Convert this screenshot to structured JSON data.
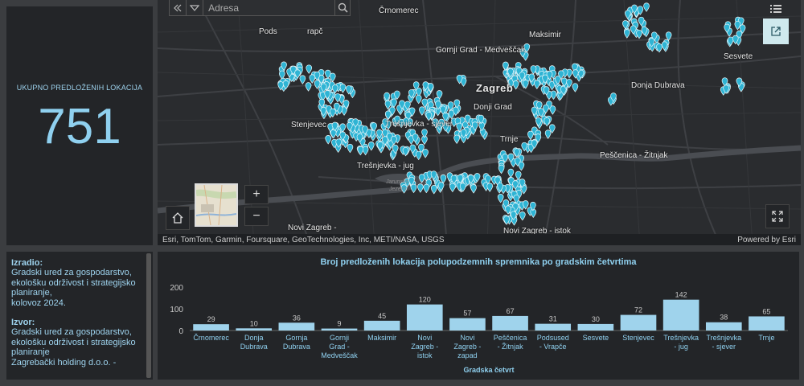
{
  "indicator": {
    "title": "UKUPNO PREDLOŽENIH LOKACIJA",
    "value": "751"
  },
  "map": {
    "search": {
      "placeholder": "Adresa"
    },
    "labels": {
      "crnomerec": "Črnomerec",
      "pods": "Pods",
      "rapc": "rapč",
      "maksimir": "Maksimir",
      "gornji_grad": "Gornji Grad - Medveščak",
      "sesvete": "Sesvete",
      "zagreb": "Zagreb",
      "donji_grad": "Donji Grad",
      "donja_dubrava": "Donja Dubrava",
      "stenjevec": "Stenjevec",
      "tresnjevka_sjever": "Trešnjevka - sjever",
      "trnje": "Trnje",
      "pescenica": "Peščenica - Žitnjak",
      "tresnjevka_jug": "Trešnjevka - jug",
      "jarunsko": "Jarunsko",
      "jezero": "Jezero",
      "novi_zagreb_zapad": "Novi Zagreb -",
      "novi_zagreb_istok": "Novi Zagreb - istok"
    },
    "attribution": "Esri, TomTom, Garmin, Foursquare, GeoTechnologies, Inc, METI/NASA, USGS",
    "powered_by": "Powered by Esri",
    "zoom_in": "+",
    "zoom_out": "−"
  },
  "info": {
    "izradio_label": "Izradio:",
    "izradio_text": "Gradski ured za gospodarstvo, ekološku održivost i strategijsko planiranje,",
    "date": "kolovoz 2024.",
    "izvor_label": "Izvor:",
    "izvor_text": "Gradski ured za gospodarstvo, ekološku održivost i strategijsko planiranje",
    "izvor_text2": "Zagrebački holding d.o.o. -"
  },
  "chart_data": {
    "type": "bar",
    "title": "Broj predloženih lokacija polupodzemnih spremnika po gradskim četvrtima",
    "xlabel": "Gradska četvrt",
    "ylabel": "",
    "ylim": [
      0,
      200
    ],
    "yticks": [
      0,
      100,
      200
    ],
    "categories": [
      "Črnomerec",
      "Donja Dubrava",
      "Gornja Dubrava",
      "Gornji Grad - Medveščak",
      "Maksimir",
      "Novi Zagreb - istok",
      "Novi Zagreb - zapad",
      "Peščenica - Žitnjak",
      "Podsused - Vrapče",
      "Sesvete",
      "Stenjevec",
      "Trešnjevka - jug",
      "Trešnjevka - sjever",
      "Trnje"
    ],
    "category_lines": [
      [
        "Črnomerec"
      ],
      [
        "Donja",
        "Dubrava"
      ],
      [
        "Gornja",
        "Dubrava"
      ],
      [
        "Gornji",
        "Grad -",
        "Medveščak"
      ],
      [
        "Maksimir"
      ],
      [
        "Novi",
        "Zagreb -",
        "istok"
      ],
      [
        "Novi",
        "Zagreb -",
        "zapad"
      ],
      [
        "Peščenica",
        "- Žitnjak"
      ],
      [
        "Podsused",
        "- Vrapče"
      ],
      [
        "Sesvete"
      ],
      [
        "Stenjevec"
      ],
      [
        "Trešnjevka",
        "- jug"
      ],
      [
        "Trešnjevka",
        "- sjever"
      ],
      [
        "Trnje"
      ]
    ],
    "values": [
      29,
      10,
      36,
      9,
      45,
      120,
      57,
      67,
      31,
      30,
      72,
      142,
      38,
      65
    ],
    "bar_color": "#9fd3ec",
    "grid": false
  },
  "colors": {
    "accent": "#8fd0ef",
    "marker": "#2fb4d4",
    "panel": "#232528",
    "background": "#3b3d40"
  }
}
